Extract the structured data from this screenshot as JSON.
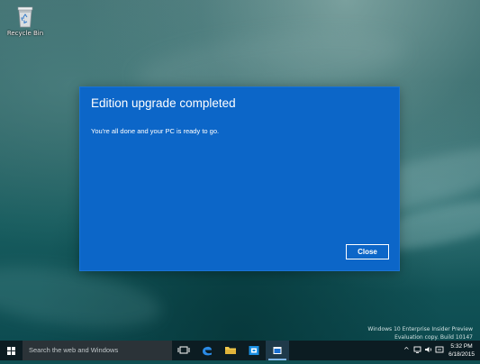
{
  "desktop": {
    "recycle_bin_label": "Recycle Bin",
    "watermark_line1": "Windows 10 Enterprise Insider Preview",
    "watermark_line2": "Evaluation copy. Build 10147"
  },
  "dialog": {
    "title": "Edition upgrade completed",
    "message": "You're all done and your PC is ready to go.",
    "close_label": "Close"
  },
  "taskbar": {
    "search_placeholder": "Search the web and Windows",
    "apps": [
      "task-view",
      "edge",
      "file-explorer",
      "store",
      "settings-app"
    ],
    "clock_time": "5:32 PM",
    "clock_date": "6/18/2015"
  },
  "colors": {
    "dialog_bg": "#0c66c8",
    "taskbar_bg": "#0c1c22",
    "accent": "#7fb6e6"
  }
}
